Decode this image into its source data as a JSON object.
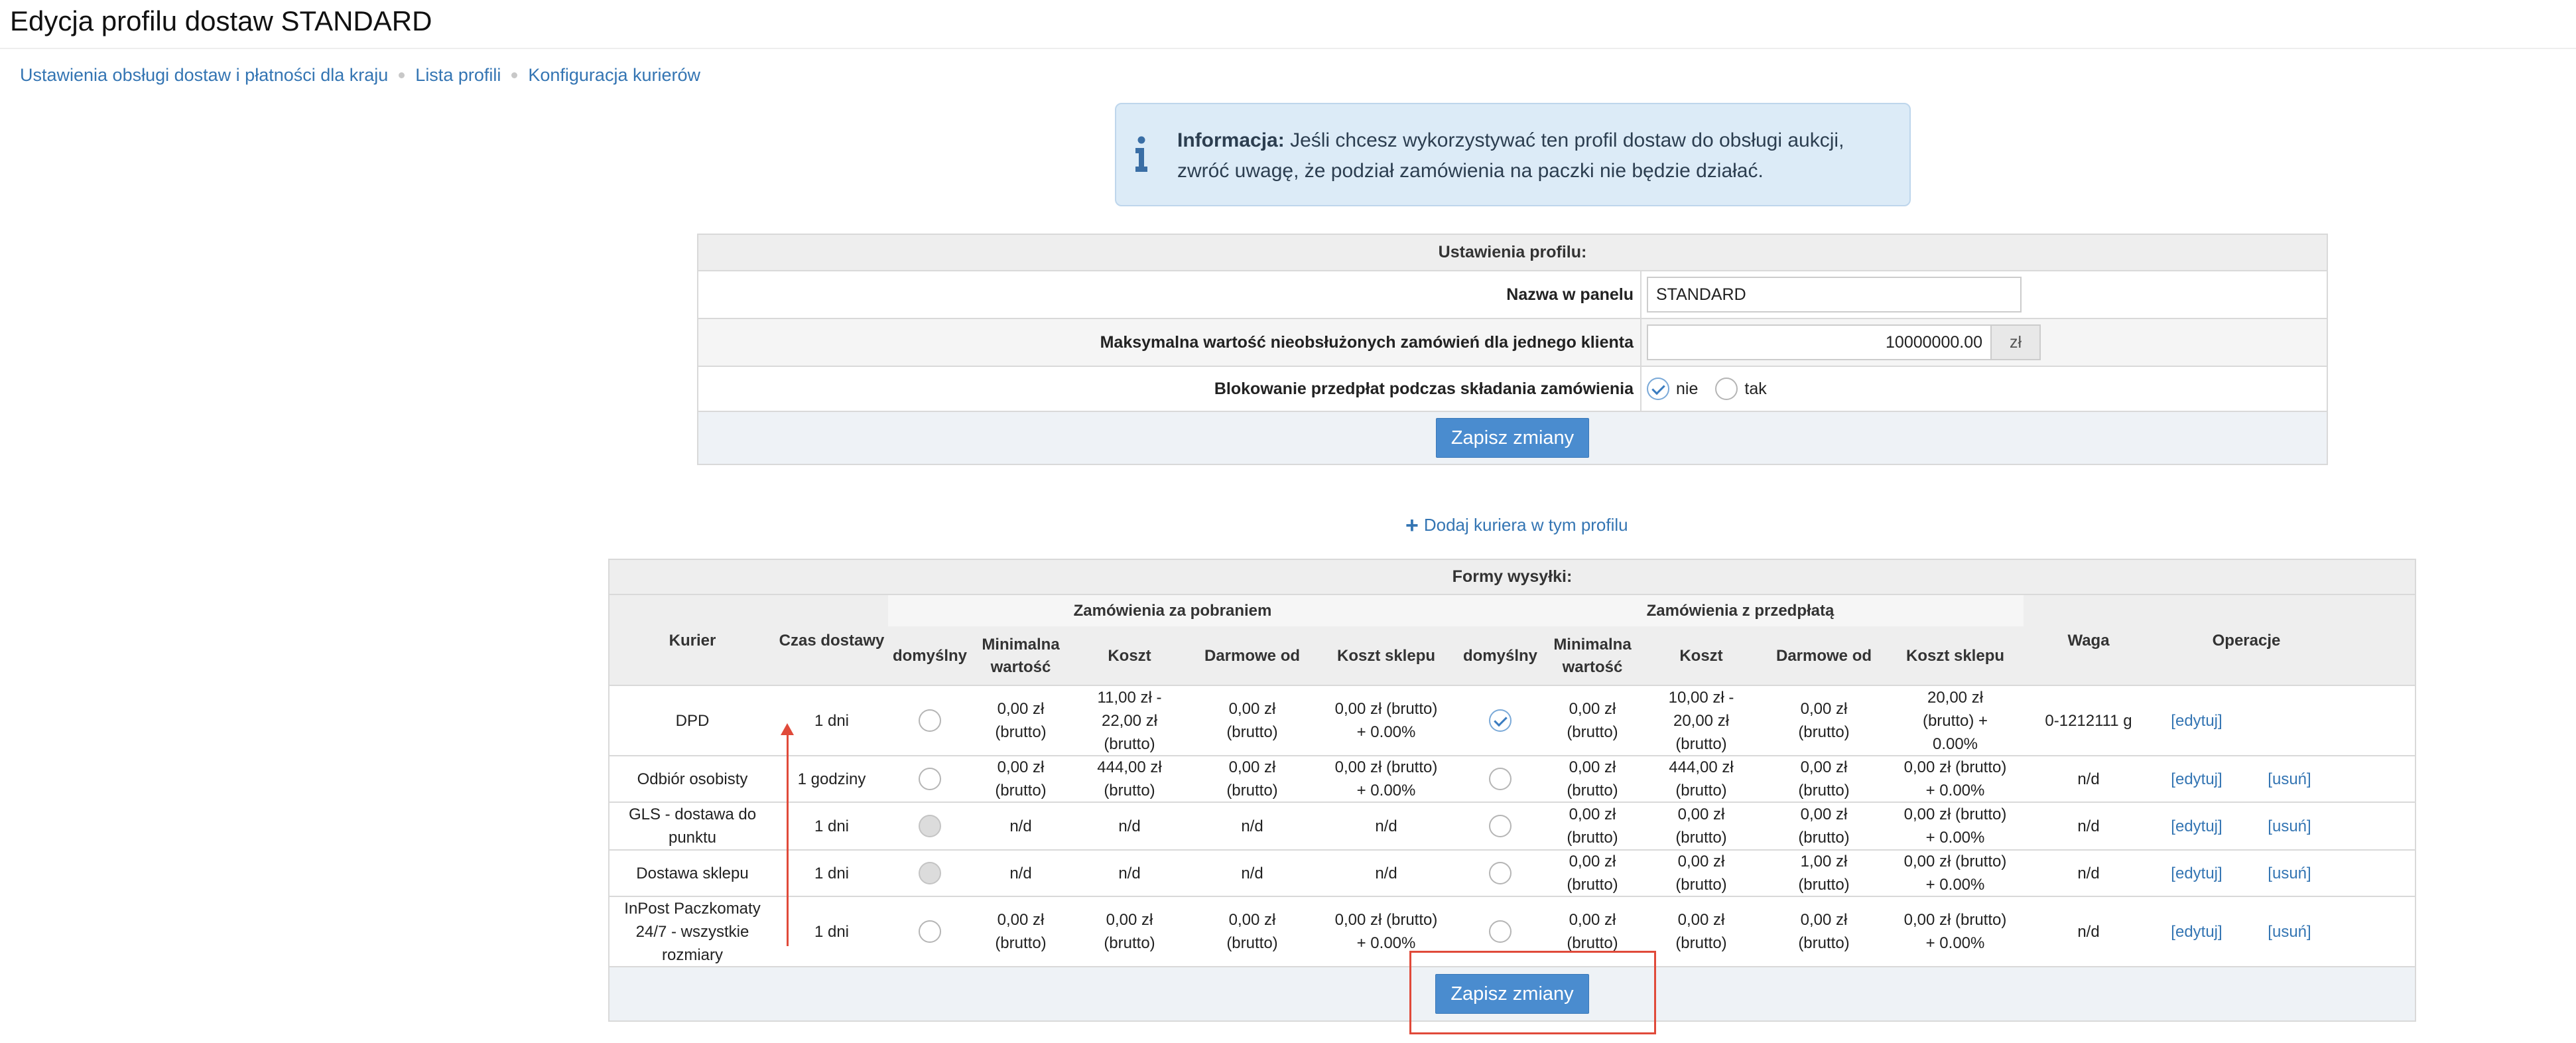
{
  "page": {
    "title": "Edycja profilu dostaw STANDARD"
  },
  "breadcrumb": [
    "Ustawienia obsługi dostaw i płatności dla kraju",
    "Lista profili",
    "Konfiguracja kurierów"
  ],
  "info": {
    "label": "Informacja:",
    "text": "Jeśli chcesz wykorzystywać ten profil dostaw do obsługi aukcji, zwróć uwagę, że podział zamówienia na paczki nie będzie działać."
  },
  "profile_settings": {
    "header": "Ustawienia profilu:",
    "name_label": "Nazwa w panelu",
    "name_value": "STANDARD",
    "max_value_label": "Maksymalna wartość nieobsłużonych zamówień dla jednego klienta",
    "max_value": "10000000.00",
    "currency": "zł",
    "block_label": "Blokowanie przedpłat podczas składania zamówienia",
    "option_no": "nie",
    "option_yes": "tak",
    "selected": "nie",
    "save_label": "Zapisz zmiany"
  },
  "add_courier": "Dodaj kuriera w tym profilu",
  "shipping": {
    "header": "Formy wysyłki:",
    "group_cod": "Zamówienia za pobraniem",
    "group_prepaid": "Zamówienia z przedpłatą",
    "col_courier": "Kurier",
    "col_time": "Czas dostawy",
    "col_default": "domyślny",
    "col_min": "Minimalna wartość",
    "col_cost": "Koszt",
    "col_free": "Darmowe od",
    "col_shop": "Koszt sklepu",
    "col_weight": "Waga",
    "col_ops": "Operacje",
    "edit_label": "[edytuj]",
    "delete_label": "[usuń]",
    "rows": [
      {
        "courier": "DPD",
        "time": "1 dni",
        "cod_default": "unchecked",
        "cod_min": "0,00 zł (brutto)",
        "cod_cost": "11,00 zł - 22,00 zł (brutto)",
        "cod_free": "0,00 zł (brutto)",
        "cod_shop": "0,00 zł (brutto) + 0.00%",
        "pre_default": "checked",
        "pre_min": "0,00 zł (brutto)",
        "pre_cost": "10,00 zł - 20,00 zł (brutto)",
        "pre_free": "0,00 zł (brutto)",
        "pre_shop": "20,00 zł (brutto) + 0.00%",
        "weight": "0-1212111 g",
        "deletable": false
      },
      {
        "courier": "Odbiór osobisty",
        "time": "1 godziny",
        "cod_default": "unchecked",
        "cod_min": "0,00 zł (brutto)",
        "cod_cost": "444,00 zł (brutto)",
        "cod_free": "0,00 zł (brutto)",
        "cod_shop": "0,00 zł (brutto) + 0.00%",
        "pre_default": "unchecked",
        "pre_min": "0,00 zł (brutto)",
        "pre_cost": "444,00 zł (brutto)",
        "pre_free": "0,00 zł (brutto)",
        "pre_shop": "0,00 zł (brutto) + 0.00%",
        "weight": "n/d",
        "deletable": true
      },
      {
        "courier": "GLS - dostawa do punktu",
        "time": "1 dni",
        "cod_default": "disabled",
        "cod_min": "n/d",
        "cod_cost": "n/d",
        "cod_free": "n/d",
        "cod_shop": "n/d",
        "pre_default": "unchecked",
        "pre_min": "0,00 zł (brutto)",
        "pre_cost": "0,00 zł (brutto)",
        "pre_free": "0,00 zł (brutto)",
        "pre_shop": "0,00 zł (brutto) + 0.00%",
        "weight": "n/d",
        "deletable": true
      },
      {
        "courier": "Dostawa sklepu",
        "time": "1 dni",
        "cod_default": "disabled",
        "cod_min": "n/d",
        "cod_cost": "n/d",
        "cod_free": "n/d",
        "cod_shop": "n/d",
        "pre_default": "unchecked",
        "pre_min": "0,00 zł (brutto)",
        "pre_cost": "0,00 zł (brutto)",
        "pre_free": "1,00 zł (brutto)",
        "pre_shop": "0,00 zł (brutto) + 0.00%",
        "weight": "n/d",
        "deletable": true
      },
      {
        "courier": "InPost Paczkomaty 24/7 - wszystkie rozmiary",
        "time": "1 dni",
        "cod_default": "unchecked",
        "cod_min": "0,00 zł (brutto)",
        "cod_cost": "0,00 zł (brutto)",
        "cod_free": "0,00 zł (brutto)",
        "cod_shop": "0,00 zł (brutto) + 0.00%",
        "pre_default": "unchecked",
        "pre_min": "0,00 zł (brutto)",
        "pre_cost": "0,00 zł (brutto)",
        "pre_free": "0,00 zł (brutto)",
        "pre_shop": "0,00 zł (brutto) + 0.00%",
        "weight": "n/d",
        "deletable": true
      }
    ],
    "save_label": "Zapisz zmiany"
  },
  "colors": {
    "link": "#3475b3",
    "button": "#4a8ccf",
    "annotation": "#e04a3a",
    "info_bg": "#dcebf7"
  }
}
